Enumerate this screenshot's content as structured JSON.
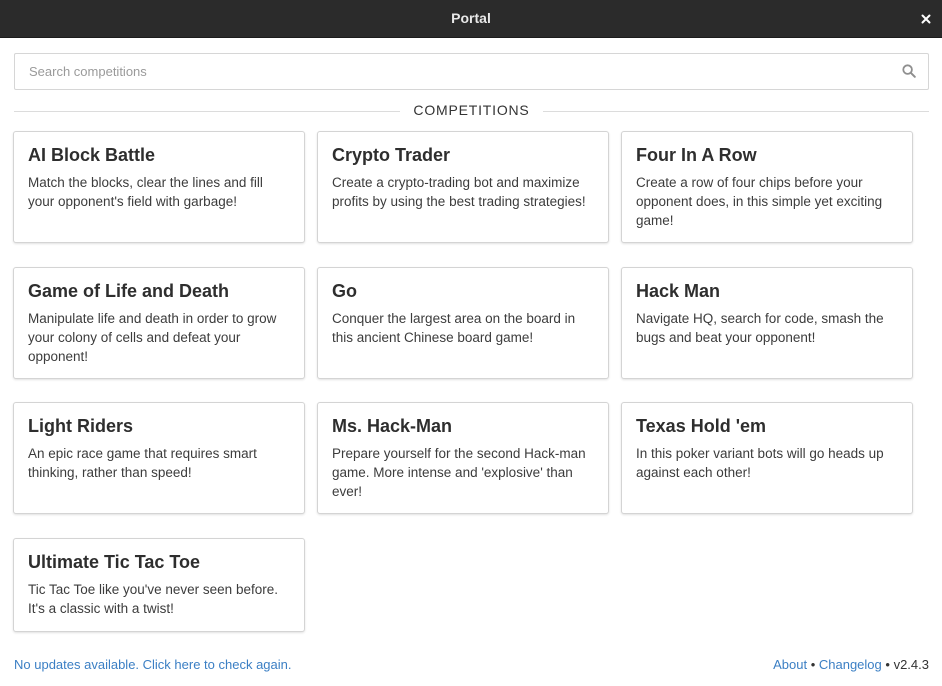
{
  "window": {
    "title": "Portal"
  },
  "search": {
    "placeholder": "Search competitions"
  },
  "section": {
    "title": "COMPETITIONS"
  },
  "competitions": [
    {
      "name": "AI Block Battle",
      "description": "Match the blocks, clear the lines and fill your opponent's field with garbage!"
    },
    {
      "name": "Crypto Trader",
      "description": "Create a crypto-trading bot and maximize profits by using the best trading strategies!"
    },
    {
      "name": "Four In A Row",
      "description": "Create a row of four chips before your opponent does, in this simple yet exciting game!"
    },
    {
      "name": "Game of Life and Death",
      "description": "Manipulate life and death in order to grow your colony of cells and defeat your opponent!"
    },
    {
      "name": "Go",
      "description": "Conquer the largest area on the board in this ancient Chinese board game!"
    },
    {
      "name": "Hack Man",
      "description": "Navigate HQ, search for code, smash the bugs and beat your opponent!"
    },
    {
      "name": "Light Riders",
      "description": "An epic race game that requires smart thinking, rather than speed!"
    },
    {
      "name": "Ms. Hack-Man",
      "description": "Prepare yourself for the second Hack-man game. More intense and 'explosive' than ever!"
    },
    {
      "name": "Texas Hold 'em",
      "description": "In this poker variant bots will go heads up against each other!"
    },
    {
      "name": "Ultimate Tic Tac Toe",
      "description": "Tic Tac Toe like you've never seen before. It's a classic with a twist!"
    }
  ],
  "footer": {
    "update_text": "No updates available. Click here to check again.",
    "about_label": "About",
    "separator": "•",
    "changelog_label": "Changelog",
    "version": "v2.4.3"
  },
  "colors": {
    "titlebar": "#2b2b2b",
    "link": "#3b7fc4",
    "card_border": "#d4d4d4"
  }
}
